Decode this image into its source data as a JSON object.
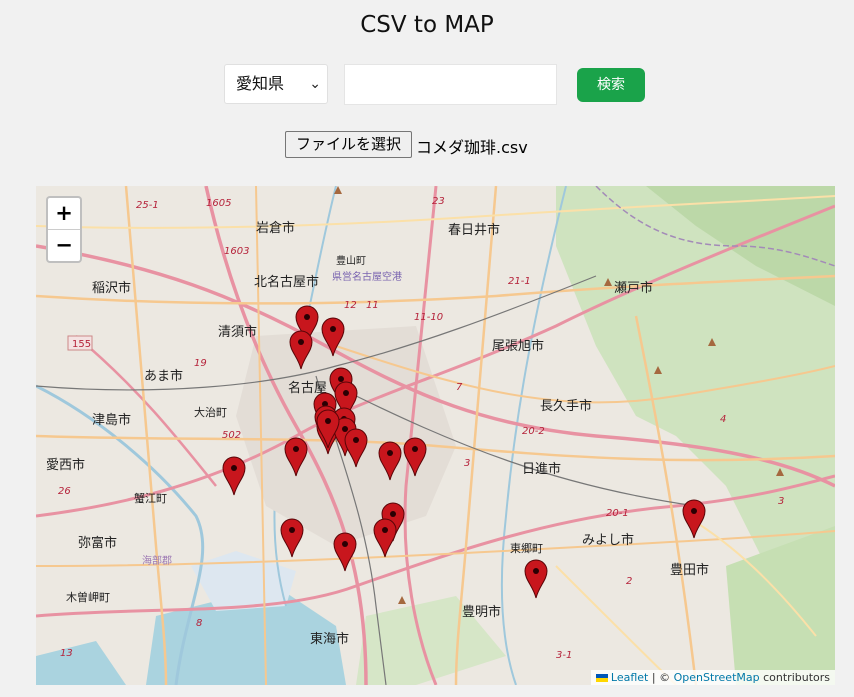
{
  "page": {
    "title": "CSV to MAP"
  },
  "controls": {
    "prefecture_selected": "愛知県",
    "search_value": "",
    "search_label": "検索"
  },
  "file": {
    "choose_label": "ファイルを選択",
    "file_name": "コメダ珈琲.csv"
  },
  "map": {
    "zoom_in": "+",
    "zoom_out": "−",
    "attribution": {
      "leaflet": "Leaflet",
      "separator": " | © ",
      "osm": "OpenStreetMap",
      "contributors": " contributors"
    },
    "places": [
      "岩倉市",
      "春日井市",
      "北名古屋市",
      "瀬戸市",
      "稲沢市",
      "清須市",
      "尾張旭市",
      "あま市",
      "名古屋",
      "長久手市",
      "津島市",
      "大治町",
      "愛西市",
      "日進市",
      "蟹江町",
      "弥富市",
      "東郷町",
      "みよし市",
      "豊田市",
      "海部郡",
      "木曽岬町",
      "豊明市",
      "東海市",
      "県営名古屋空港",
      "豊山町"
    ],
    "marker_color": "#c8161d",
    "marker_count": 22
  }
}
